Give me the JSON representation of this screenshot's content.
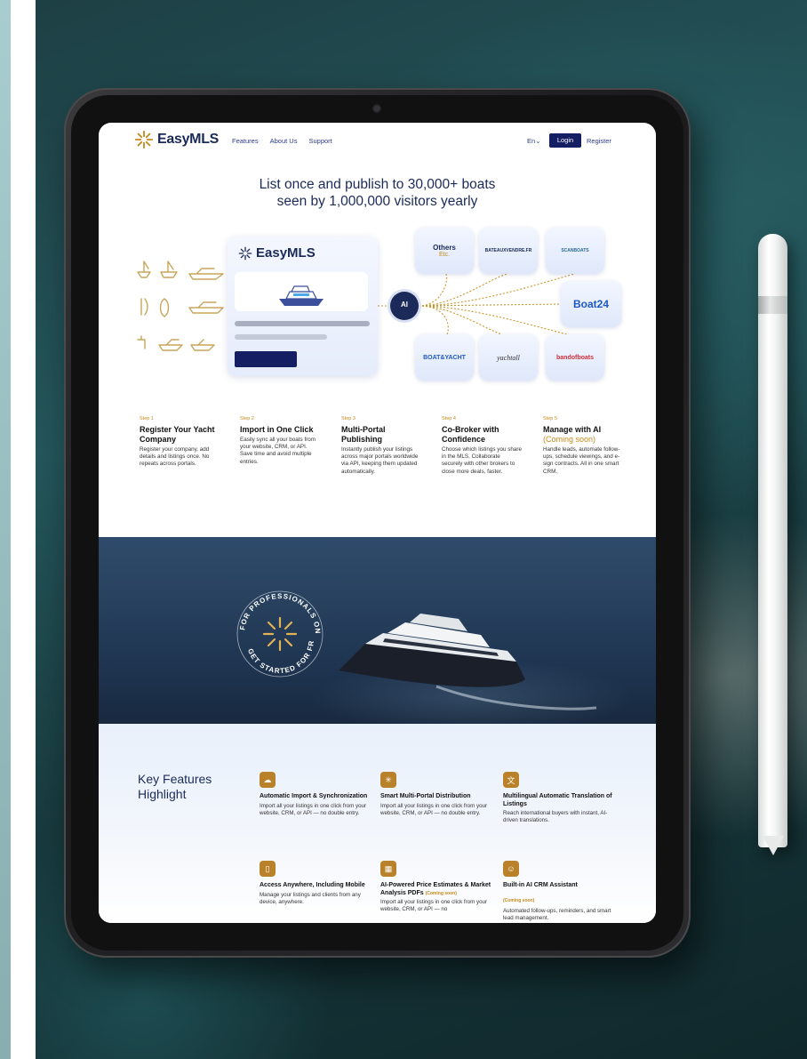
{
  "header": {
    "logo_text": "EasyMLS",
    "nav": [
      "Features",
      "About Us",
      "Support"
    ],
    "lang": "En",
    "login_label": "Login",
    "register_label": "Register"
  },
  "hero": {
    "title_line1": "List once and publish to 30,000+ boats",
    "title_line2": "seen by 1,000,000 visitors yearly",
    "card_logo": "EasyMLS",
    "hub_label": "AI"
  },
  "portals": {
    "others_title": "Others",
    "others_sub": "Etc.",
    "bateau": "BATEAUXVENDRE.FR",
    "scan": "SCANBOATS",
    "boat24": "Boat24",
    "boat_yacht": "BOAT&YACHT",
    "yachtall": "yachtall",
    "band_of_boats": "bandofboats"
  },
  "steps": [
    {
      "label": "Step 1",
      "title": "Register Your Yacht Company",
      "soon": "",
      "desc": "Register your company, add details and listings once. No repeats across portals."
    },
    {
      "label": "Step 2",
      "title": "Import in One Click",
      "soon": "",
      "desc": "Easily sync all your boats from your website, CRM, or API. Save time and avoid multiple entries."
    },
    {
      "label": "Step 3",
      "title": "Multi-Portal Publishing",
      "soon": "",
      "desc": "Instantly publish your listings across major portals worldwide via API, keeping them updated automatically."
    },
    {
      "label": "Step 4",
      "title": "Co-Broker with Confidence",
      "soon": "",
      "desc": "Choose which listings you share in the MLS. Collaborate securely with other brokers to close more deals, faster."
    },
    {
      "label": "Step 5",
      "title": "Manage with AI",
      "soon": "(Coming soon)",
      "desc": "Handle leads, automate follow-ups, schedule viewings, and e-sign contracts. All in one smart CRM."
    }
  ],
  "badge": {
    "top_text": "FOR PROFESSIONALS ONLY",
    "bottom_text": "GET STARTED FOR FREE"
  },
  "features": {
    "title": "Key Features Highlight",
    "items": [
      {
        "title": "Automatic Import & Synchronization",
        "soon": "",
        "desc": "Import all your listings in one click from your website, CRM, or API — no double entry.",
        "icon": "cloud-sync-icon"
      },
      {
        "title": "Smart Multi-Portal Distribution",
        "soon": "",
        "desc": "Import all your listings in one click from your website, CRM, or API — no double entry.",
        "icon": "distribution-icon"
      },
      {
        "title": "Multilingual Automatic Translation of Listings",
        "soon": "",
        "desc": "Reach international buyers with instant, AI-driven translations.",
        "icon": "translate-icon"
      },
      {
        "title": "Access Anywhere, Including Mobile",
        "soon": "",
        "desc": "Manage your listings and clients from any device, anywhere.",
        "icon": "mobile-icon"
      },
      {
        "title": "AI-Powered Price Estimates & Market Analysis PDFs",
        "soon": "(Coming soon)",
        "desc": "Import all your listings in one click from your website, CRM, or API — no",
        "icon": "ai-chart-icon"
      },
      {
        "title": "Built-in AI CRM Assistant",
        "soon": "(Coming soon)",
        "desc": "Automated follow-ups, reminders, and smart lead management.",
        "icon": "robot-icon"
      }
    ]
  },
  "colors": {
    "brand_navy": "#141e63",
    "accent_gold": "#c48a1c"
  }
}
